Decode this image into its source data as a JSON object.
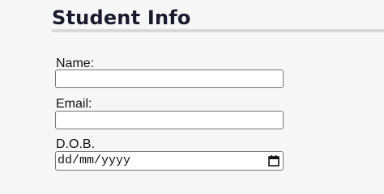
{
  "form": {
    "title": "Student Info",
    "fields": [
      {
        "label": "Name:",
        "type": "text",
        "value": ""
      },
      {
        "label": "Email:",
        "type": "email",
        "value": ""
      },
      {
        "label": "D.O.B.",
        "type": "date",
        "placeholder": "dd/mm/yyyy",
        "icon": "calendar-icon"
      }
    ]
  },
  "colors": {
    "background": "#f6f6f6",
    "title": "#1a1a2e",
    "rule": "#d9d9d9",
    "input_border": "#767676"
  }
}
